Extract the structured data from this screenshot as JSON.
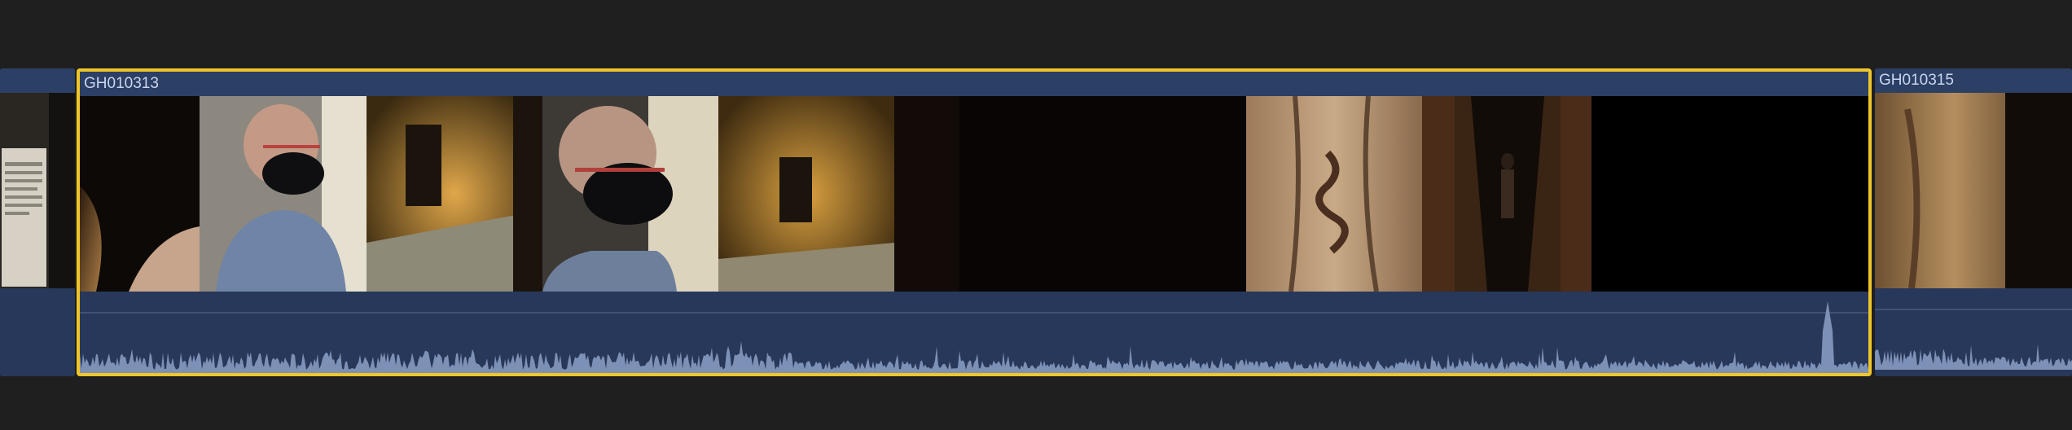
{
  "timeline": {
    "clips": [
      {
        "name": "",
        "selected": false
      },
      {
        "name": "GH010313",
        "selected": true
      },
      {
        "name": "GH010315",
        "selected": false
      }
    ]
  },
  "colors": {
    "background": "#1f1f1f",
    "clip_header": "#2c3f64",
    "audio_lane": "#27385a",
    "waveform": "#7d90b6",
    "selection": "#f0c52a"
  }
}
